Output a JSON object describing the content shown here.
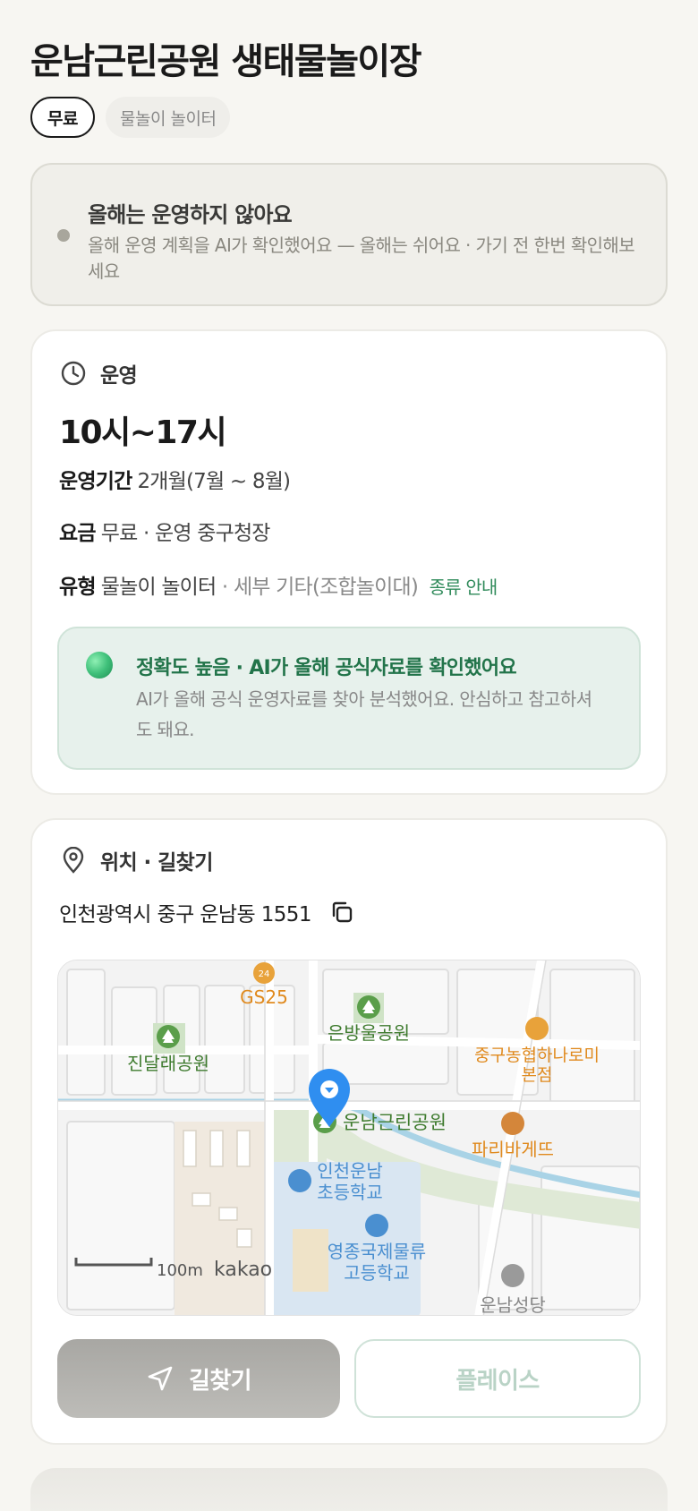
{
  "title": "운남근린공원 생태물놀이장",
  "chips": {
    "free": "무료",
    "type": "물놀이 놀이터"
  },
  "notice": {
    "title": "올해는 운영하지 않아요",
    "desc": "올해 운영 계획을 AI가 확인했어요 — 올해는 쉬어요 · 가기 전 한번 확인해보세요"
  },
  "operation": {
    "section_label": "운영",
    "hours": "10시~17시",
    "period_label": "운영기간",
    "period_value": "2개월(7월 ~ 8월)",
    "fee_label": "요금",
    "fee_value": "무료 · 운영 중구청장",
    "type_label": "유형",
    "type_value": "물놀이 놀이터",
    "type_detail": "· 세부 기타(조합놀이대)",
    "type_link": "종류 안내",
    "accuracy": {
      "title": "정확도 높음 · AI가 올해 공식자료를 확인했어요",
      "desc": "AI가 올해 공식 운영자료를 찾아 분석했어요. 안심하고 참고하셔도 돼요."
    }
  },
  "location": {
    "section_label": "위치 · 길찾기",
    "address": "인천광역시 중구 운남동 1551",
    "map": {
      "labels": {
        "gs25": "GS25",
        "gs25_badge": "24",
        "park1": "진달래공원",
        "park2": "은방울공원",
        "park3": "운남근린공원",
        "store1_line1": "중구농협하나로미",
        "store1_line2": "본점",
        "store2": "파리바게뜨",
        "school1_line1": "인천운남",
        "school1_line2": "초등학교",
        "school2_line1": "영종국제물류",
        "school2_line2": "고등학교",
        "church": "운남성당",
        "scale": "100m",
        "brand": "kakao"
      }
    },
    "directions_button": "길찾기",
    "place_button": "플레이스"
  },
  "colors": {
    "accent_green": "#2f8a5a",
    "marker_blue": "#2f8ef0",
    "poi_orange": "#e08a1e",
    "school_blue": "#4a8fd0"
  }
}
